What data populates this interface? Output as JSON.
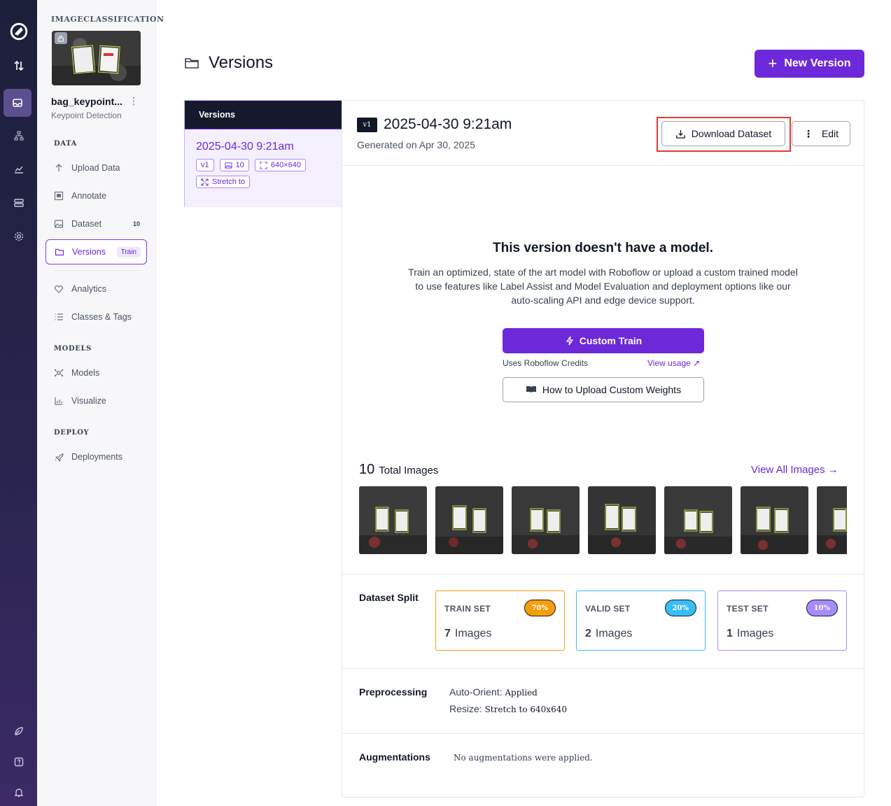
{
  "rail": {
    "icons": [
      "roboflow-logo",
      "transfer-icon",
      "projects-icon",
      "workflows-icon",
      "monitoring-icon",
      "data-icon",
      "settings-icon",
      "leaf-icon",
      "help-icon",
      "bell-icon"
    ]
  },
  "project": {
    "workspace": "IMAGECLASSIFICATION",
    "name": "bag_keypoint...",
    "type": "Keypoint Detection"
  },
  "sidebar": {
    "sections": {
      "data": "DATA",
      "models": "MODELS",
      "deploy": "DEPLOY"
    },
    "items": {
      "upload": "Upload Data",
      "annotate": "Annotate",
      "dataset": "Dataset",
      "dataset_count": "10",
      "versions": "Versions",
      "versions_pill": "Train",
      "analytics": "Analytics",
      "classes": "Classes & Tags",
      "models": "Models",
      "visualize": "Visualize",
      "deployments": "Deployments"
    }
  },
  "header": {
    "title": "Versions",
    "new_version": "New Version"
  },
  "versions_list": {
    "heading": "Versions",
    "selected": {
      "title": "2025-04-30 9:21am",
      "tag_version": "v1",
      "tag_images": "10",
      "tag_size": "640×640",
      "tag_resize": "Stretch to"
    }
  },
  "version": {
    "badge": "v1",
    "title": "2025-04-30 9:21am",
    "generated": "Generated on Apr 30, 2025",
    "download": "Download Dataset",
    "edit": "Edit"
  },
  "no_model": {
    "title": "This version doesn't have a model.",
    "description": "Train an optimized, state of the art model with Roboflow or upload a custom trained model to use features like Label Assist and Model Evaluation and deployment options like our auto-scaling API and edge device support.",
    "train_button": "Custom Train",
    "credits": "Uses Roboflow Credits",
    "view_usage": "View usage ↗",
    "weights_button": "How to Upload Custom Weights"
  },
  "images": {
    "count": "10",
    "label": "Total Images",
    "view_all": "View All Images →"
  },
  "split": {
    "label": "Dataset Split",
    "train": {
      "name": "TRAIN SET",
      "pct": "70%",
      "count": "7",
      "unit": "Images",
      "color": "#f59e0b"
    },
    "valid": {
      "name": "VALID SET",
      "pct": "20%",
      "count": "2",
      "unit": "Images",
      "color": "#38bdf8"
    },
    "test": {
      "name": "TEST SET",
      "pct": "10%",
      "count": "1",
      "unit": "Images",
      "color": "#a78bfa"
    }
  },
  "preprocessing": {
    "label": "Preprocessing",
    "auto_orient_key": "Auto-Orient:",
    "auto_orient_val": "Applied",
    "resize_key": "Resize:",
    "resize_val": "Stretch to 640x640"
  },
  "augmentations": {
    "label": "Augmentations",
    "value": "No augmentations were applied."
  }
}
